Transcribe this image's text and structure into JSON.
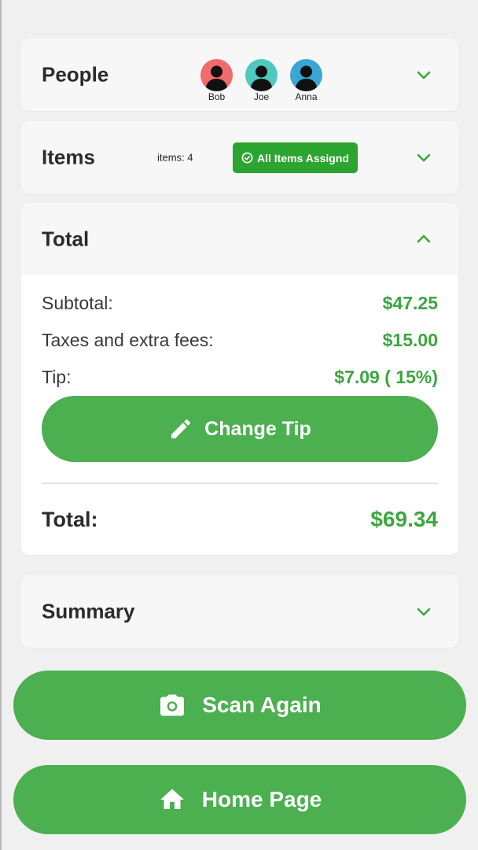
{
  "people": {
    "title": "People",
    "avatars": [
      {
        "name": "Bob",
        "color": "#f26a6a"
      },
      {
        "name": "Joe",
        "color": "#4fc9c0"
      },
      {
        "name": "Anna",
        "color": "#3aa6d6"
      }
    ]
  },
  "items": {
    "title": "Items",
    "count_label": "items: 4",
    "badge": "All Items Assignd"
  },
  "total_section": {
    "title": "Total",
    "subtotal_label": "Subtotal:",
    "subtotal_value": "$47.25",
    "taxes_label": "Taxes and extra fees:",
    "taxes_value": "$15.00",
    "tip_label": "Tip:",
    "tip_value": "$7.09 ( 15%)",
    "change_tip_label": "Change Tip",
    "total_label": "Total:",
    "total_value": "$69.34"
  },
  "summary": {
    "title": "Summary"
  },
  "actions": {
    "scan_again_label": "Scan Again",
    "home_page_label": "Home Page"
  },
  "colors": {
    "accent": "#4caf50",
    "accent_text": "#3ca63f",
    "badge": "#2ba52f"
  },
  "icons": {
    "chevron": "chevron-down-icon",
    "chevron_up": "chevron-up-icon",
    "pencil": "pencil-icon",
    "camera": "camera-icon",
    "home": "home-icon",
    "check": "check-circle-icon",
    "person": "person-icon"
  }
}
